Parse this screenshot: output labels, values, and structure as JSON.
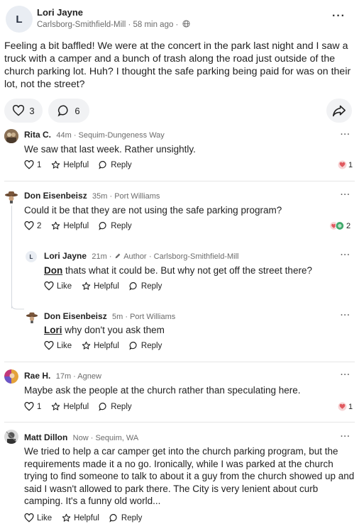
{
  "post": {
    "avatar_initial": "L",
    "author": "Lori Jayne",
    "meta": "Carlsborg-Smithfield-Mill · 58 min ago ·",
    "body": "Feeling a bit baffled! We were at the concert in the park last night and I saw a truck with a camper and a bunch of trash along the road just outside of the church parking lot. Huh? I thought the safe parking being paid for was on their lot, not the street?",
    "likes": "3",
    "comments": "6"
  },
  "comments": [
    {
      "name": "Rita C.",
      "meta": "44m · Sequim-Dungeness Way",
      "text": "We saw that last week. Rather unsightly.",
      "like_count": "1",
      "helpful": "Helpful",
      "reply": "Reply",
      "reaction_count": "1"
    },
    {
      "name": "Don Eisenbeisz",
      "meta": "35m · Port Williams",
      "text": "Could it be that they are not using the safe parking program?",
      "like_count": "2",
      "helpful": "Helpful",
      "reply": "Reply",
      "reaction_count": "2"
    },
    {
      "name": "Rae H.",
      "meta": "17m · Agnew",
      "text": "Maybe ask the people at the church rather than speculating here.",
      "like_count": "1",
      "helpful": "Helpful",
      "reply": "Reply",
      "reaction_count": "1"
    },
    {
      "name": "Matt Dillon",
      "meta": "Now · Sequim, WA",
      "text": "We tried to help a car camper get into the church parking program, but the requirements made it a no go. Ironically, while I was parked at the church trying to find someone to talk to about it a guy from the church showed up and said I wasn't allowed to park there. The City is very lenient about curb camping. It's a funny old world...",
      "like_label": "Like",
      "helpful": "Helpful",
      "reply": "Reply"
    }
  ],
  "replies": [
    {
      "avatar_initial": "L",
      "name": "Lori Jayne",
      "meta": "21m ·",
      "author_tag": "Author",
      "meta2": "· Carlsborg-Smithfield-Mill",
      "mention": "Don",
      "text": " thats what it could be. But why not get off the street there?",
      "like_label": "Like",
      "helpful": "Helpful",
      "reply": "Reply"
    },
    {
      "name": "Don Eisenbeisz",
      "meta": "5m · Port Williams",
      "mention": "Lori",
      "text": " why don't you ask them",
      "like_label": "Like",
      "helpful": "Helpful",
      "reply": "Reply"
    }
  ],
  "more_glyph": "···",
  "colors": {
    "reaction_red": "#e0595f",
    "reaction_green": "#3fa86b",
    "thread_line": "#d4d8de"
  }
}
